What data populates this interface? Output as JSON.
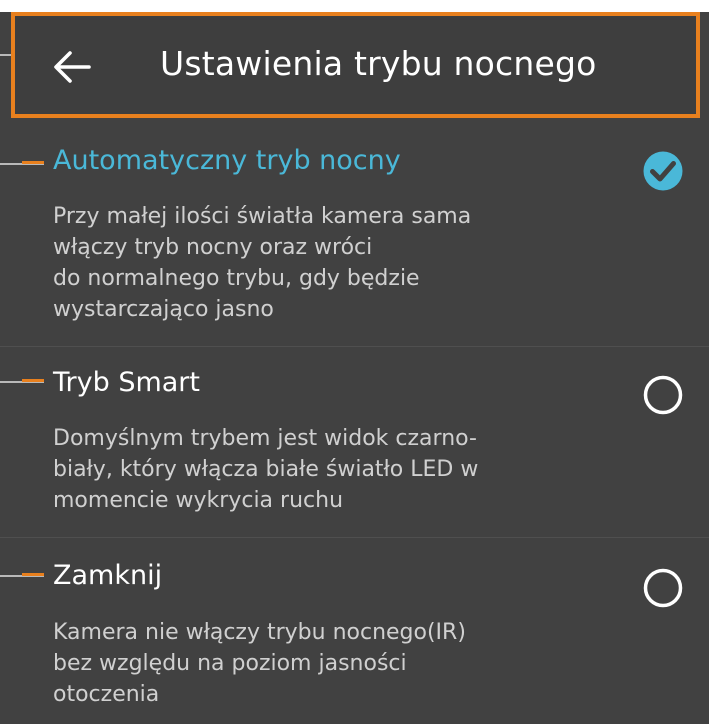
{
  "header": {
    "title": "Ustawienia trybu nocnego",
    "back_icon": "arrow-left-icon"
  },
  "options": [
    {
      "title": "Automatyczny tryb nocny",
      "description": "Przy małej ilości światła kamera sama\nwłączy tryb nocny oraz wróci\ndo normalnego trybu, gdy będzie\nwystarczająco jasno",
      "selected": true
    },
    {
      "title": "Tryb Smart",
      "description": "Domyślnym trybem jest widok czarno-\nbiały, który włącza białe światło LED w\nmomencie wykrycia ruchu",
      "selected": false
    },
    {
      "title": "Zamknij",
      "description": "Kamera nie włączy trybu nocnego(IR)\nbez względu na poziom jasności\notoczenia",
      "selected": false
    }
  ],
  "colors": {
    "accent": "#4ab8d8",
    "annotation": "#e8801e",
    "background": "#414141",
    "text": "#ffffff",
    "muted_text": "#d0d0d0"
  }
}
